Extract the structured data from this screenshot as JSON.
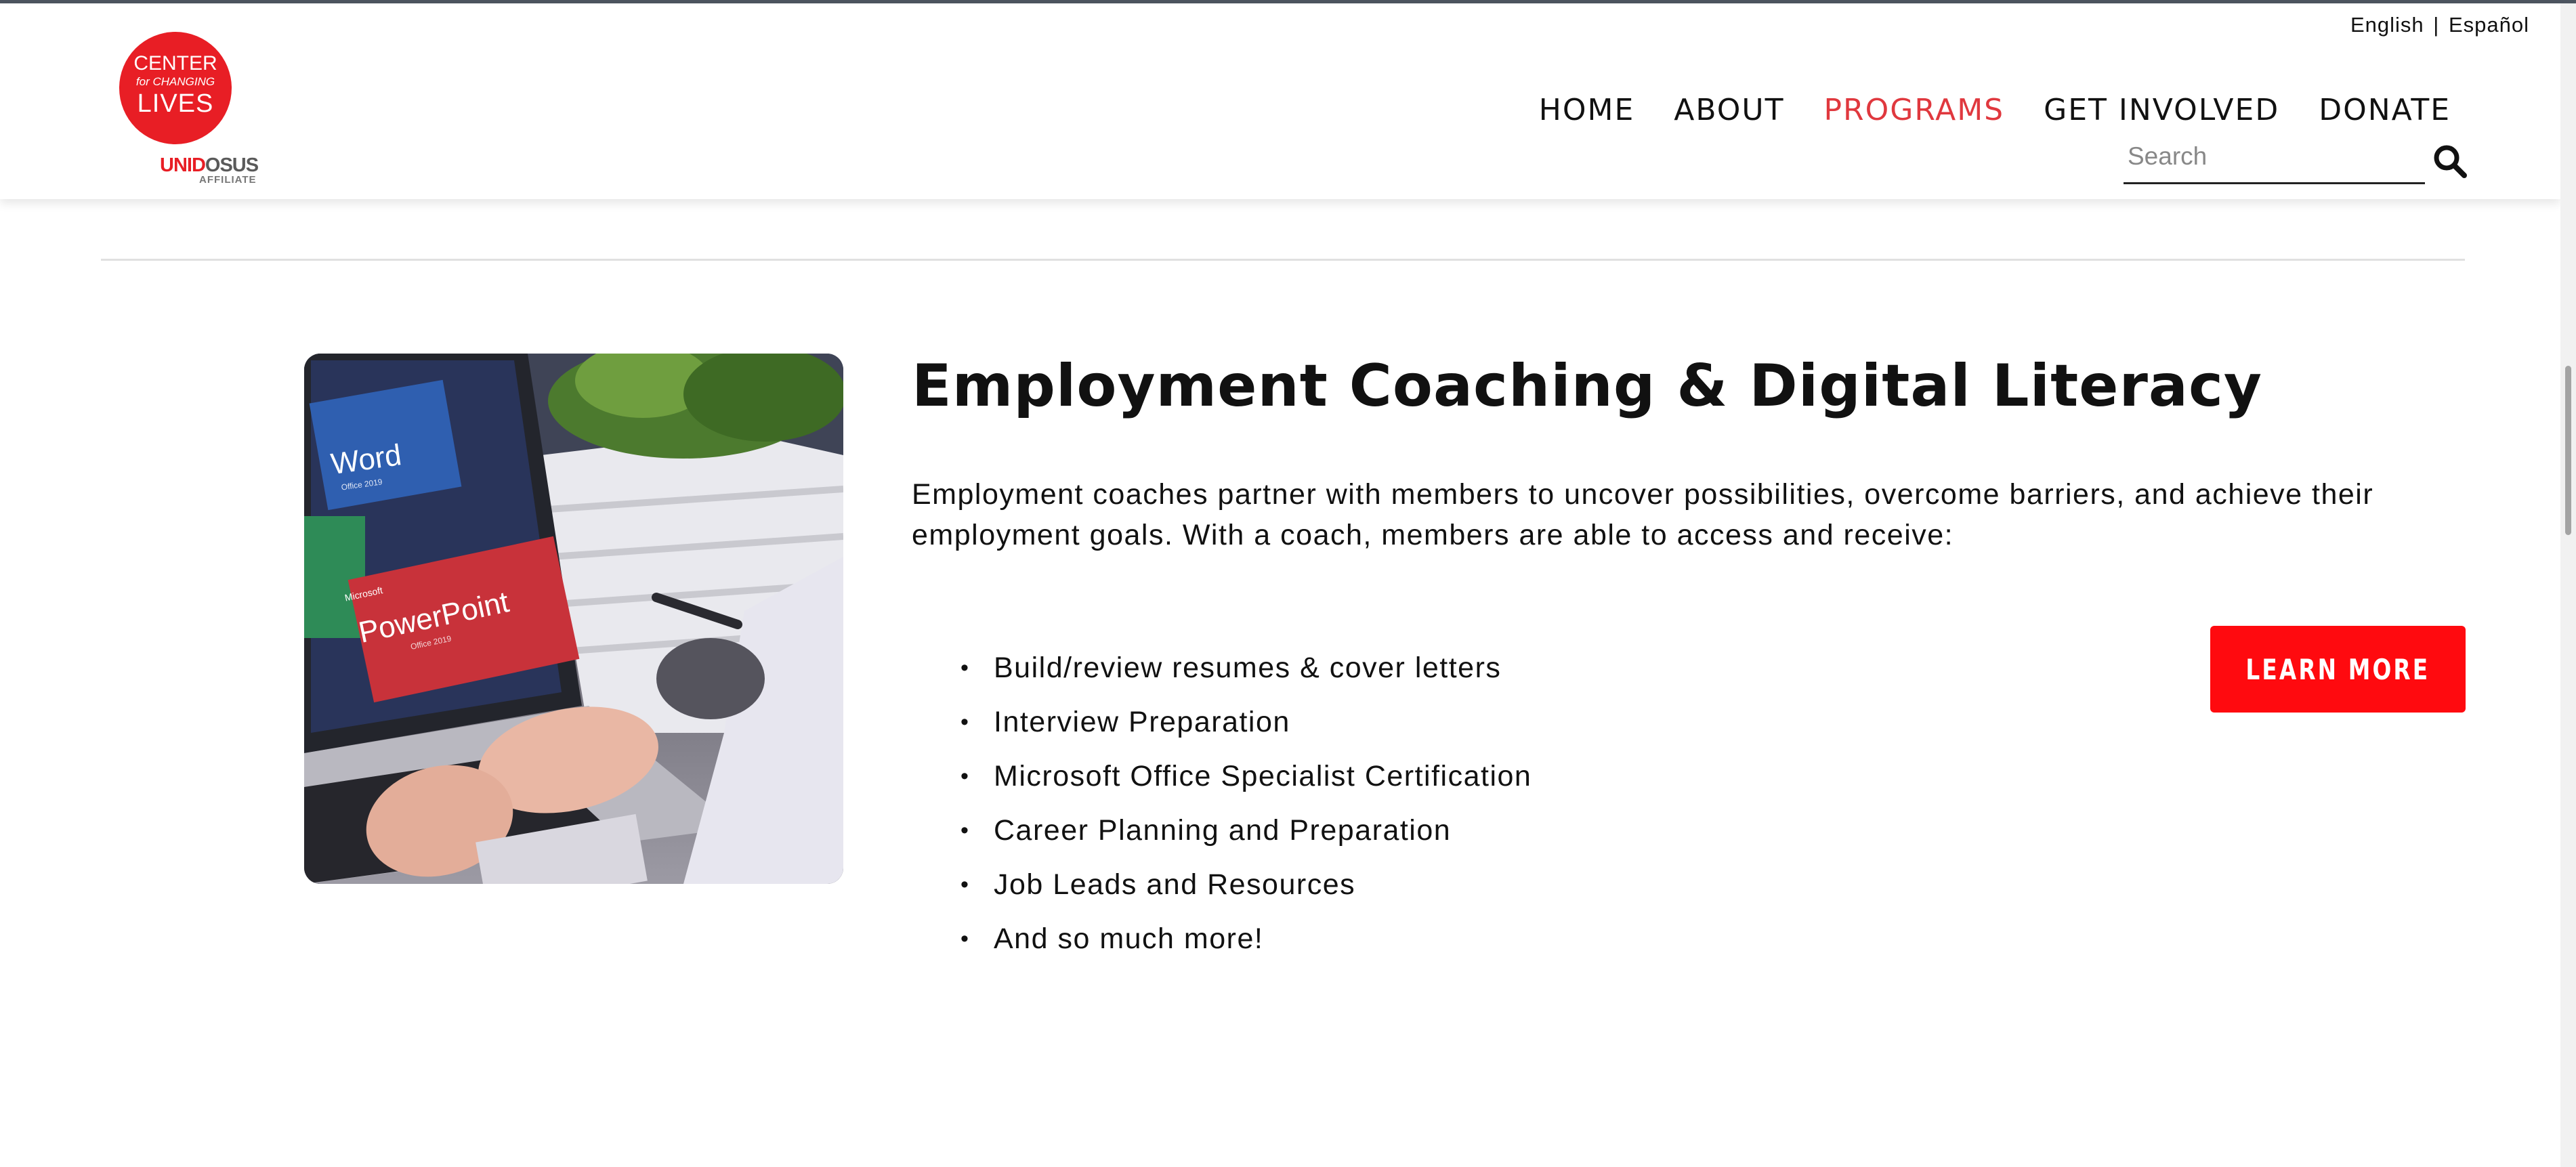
{
  "header": {
    "language": {
      "english": "English",
      "separator": "|",
      "spanish": "Español"
    },
    "logo": {
      "line1": "CENTER",
      "line2": "for CHANGING",
      "line3": "LIVES",
      "affiliate_brand_a": "UNID",
      "affiliate_brand_b": "OSUS",
      "affiliate_sub": "AFFILIATE"
    },
    "nav": [
      {
        "label": "HOME",
        "active": false
      },
      {
        "label": "ABOUT",
        "active": false
      },
      {
        "label": "PROGRAMS",
        "active": true
      },
      {
        "label": "GET INVOLVED",
        "active": false
      },
      {
        "label": "DONATE",
        "active": false
      }
    ],
    "search": {
      "placeholder": "Search",
      "value": "",
      "icon": "search-icon"
    }
  },
  "program": {
    "title": "Employment Coaching & Digital Literacy",
    "intro": "Employment coaches partner with members to uncover possibilities, overcome barriers, and achieve their employment goals. With a coach, members are able to access and receive:",
    "bullets": [
      "Build/review resumes & cover letters",
      "Interview Preparation",
      "Microsoft Office Specialist Certification",
      "Career Planning and Preparation",
      "Job Leads and Resources",
      "And so much more!"
    ],
    "button_label": "LEARN MORE",
    "photo": {
      "window1_title": "Word",
      "window1_sub": "Office 2019",
      "window2_brand": "Microsoft",
      "window2_title": "PowerPoint",
      "window2_sub": "Office 2019"
    }
  },
  "colors": {
    "accent": "#e0383e",
    "button": "#ff0a0f",
    "logo": "#e81e25"
  }
}
